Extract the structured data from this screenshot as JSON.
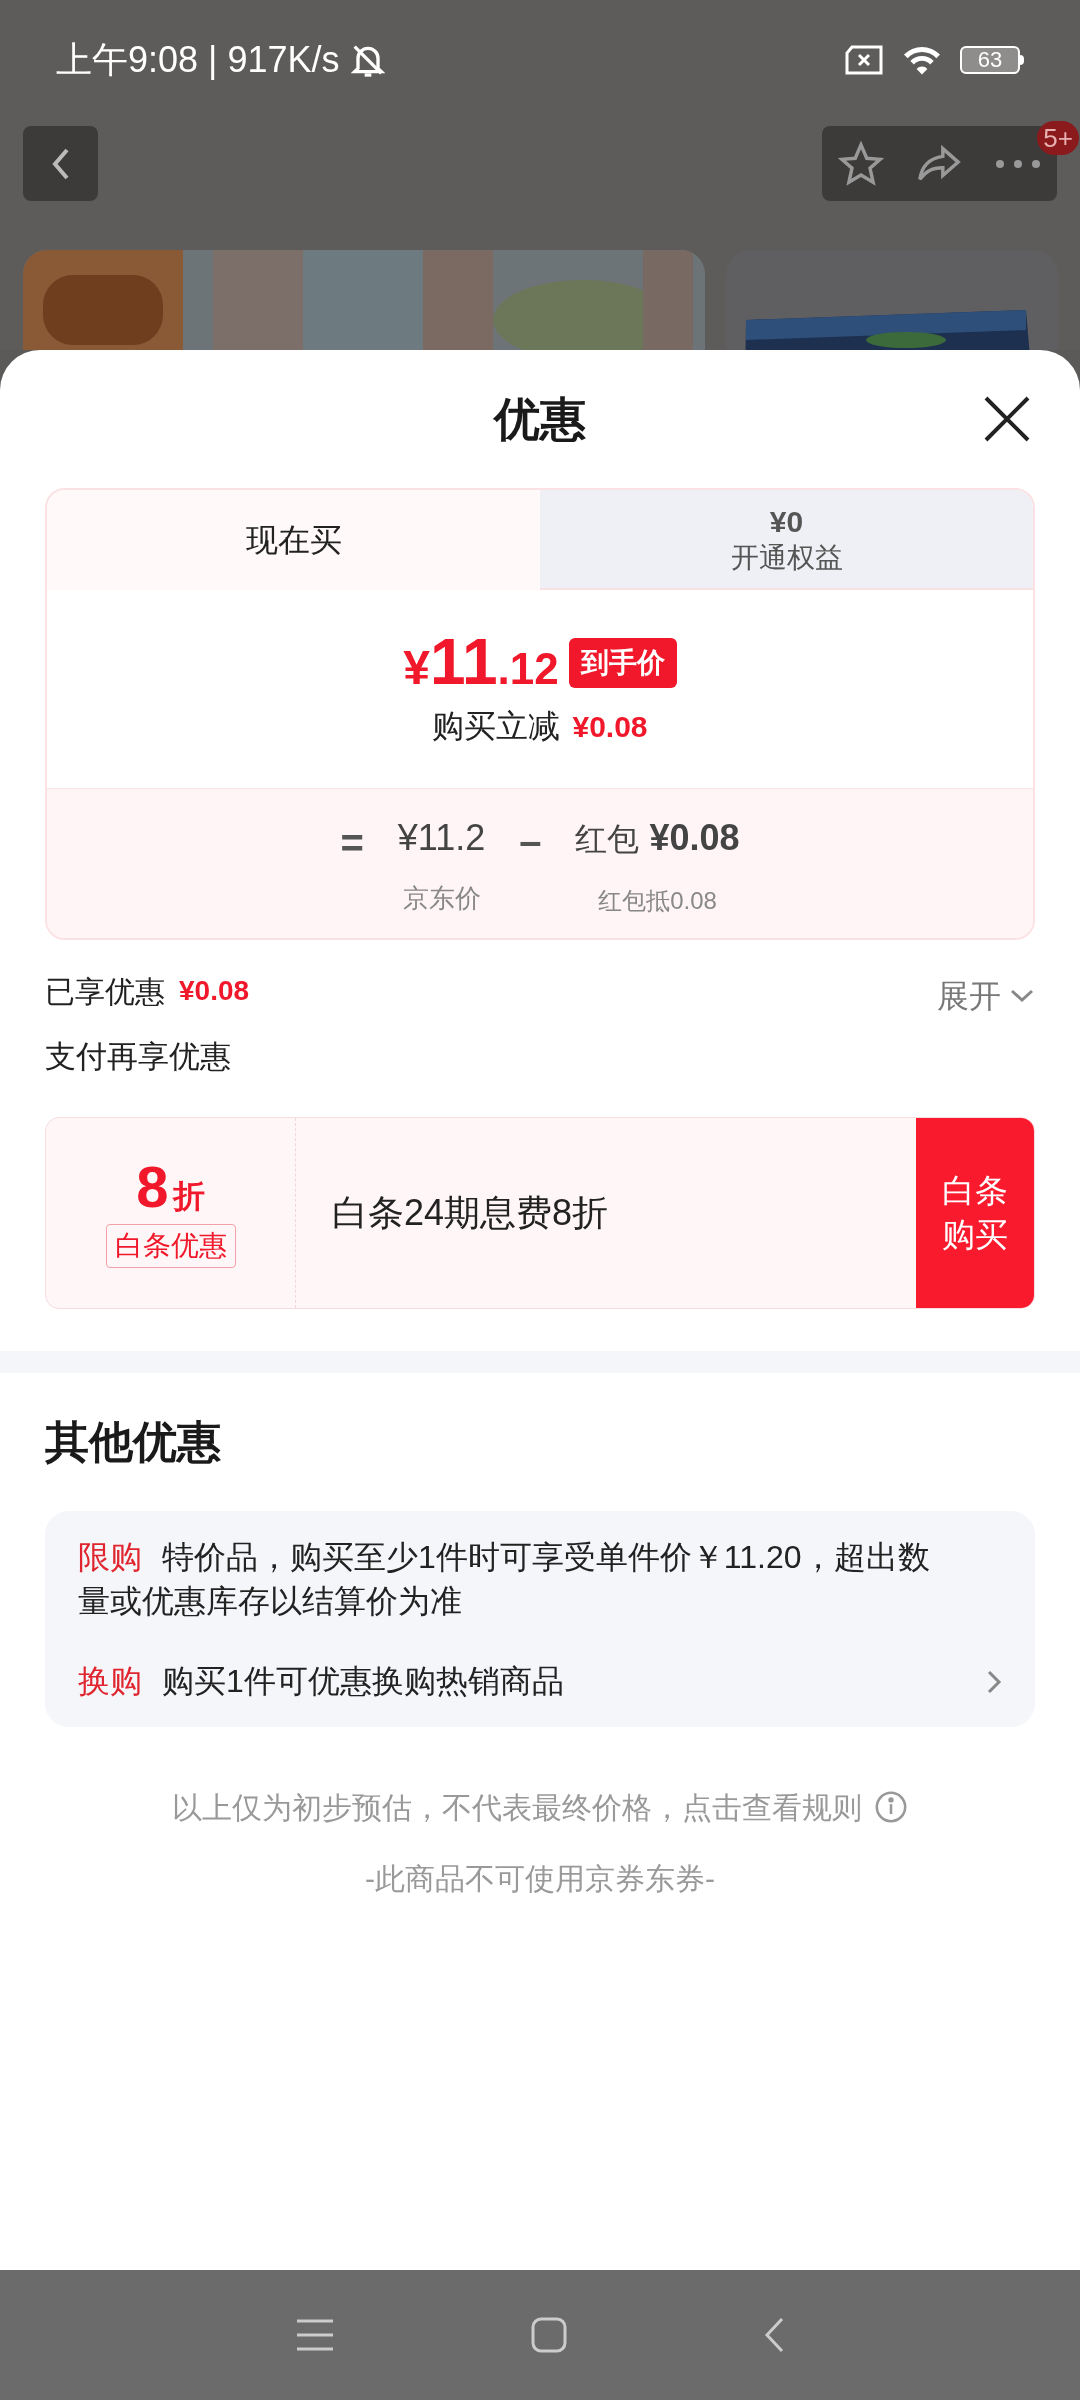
{
  "status_bar": {
    "time": "上午9:08 | 917K/s",
    "battery": "63"
  },
  "header": {
    "badge": "5+"
  },
  "sheet": {
    "title": "优惠",
    "tabs": [
      {
        "label": "现在买",
        "selected": true
      },
      {
        "price": "¥0",
        "label": "开通权益",
        "selected": false
      }
    ],
    "price": {
      "symbol": "¥",
      "integer": "11",
      "decimal": ".12",
      "tag": "到手价",
      "reduction_label": "购买立减",
      "reduction": "¥0.08"
    },
    "breakdown": {
      "equals": "=",
      "jd_price": "¥11.2",
      "minus": "–",
      "hongbao_label": "红包",
      "hongbao_value": "¥0.08",
      "jd_price_label": "京东价",
      "hongbao_caption": "红包抵0.08"
    },
    "enjoyed": {
      "label": "已享优惠",
      "amount": "¥0.08",
      "toggle": "展开",
      "expanded": false
    },
    "pay": {
      "title": "支付再享优惠",
      "discount": "8",
      "unit": "折",
      "tag": "白条优惠",
      "description": "白条24期息费8折",
      "button": "白条购买"
    },
    "other": {
      "title": "其他优惠",
      "items": [
        {
          "tag": "限购",
          "text": "特价品，购买至少1件时可享受单件价￥11.20，超出数量或优惠库存以结算价为准",
          "chevron": false
        },
        {
          "tag": "换购",
          "text": "购买1件可优惠换购热销商品",
          "chevron": true
        }
      ]
    },
    "note": "以上仅为初步预估，不代表最终价格，点击查看规则",
    "coupon_note": "-此商品不可使用京券东券-"
  }
}
